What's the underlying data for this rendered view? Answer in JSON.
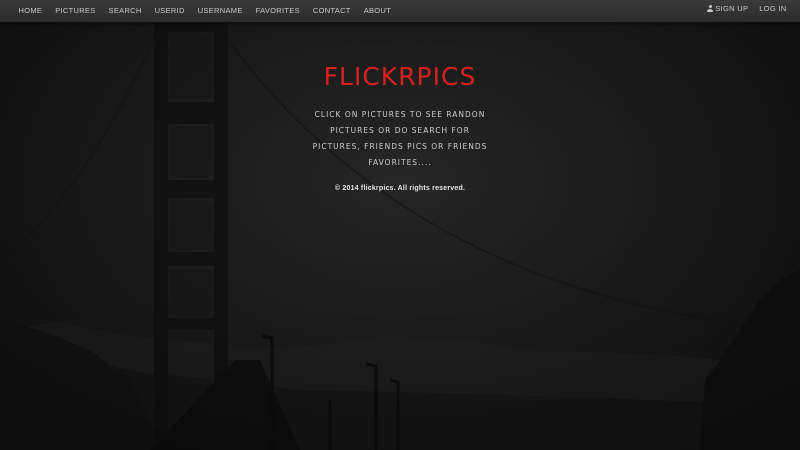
{
  "navbar": {
    "left_items": [
      {
        "label": "HOME"
      },
      {
        "label": "PICTURES"
      },
      {
        "label": "SEARCH"
      },
      {
        "label": "USERID"
      },
      {
        "label": "USERNAME"
      },
      {
        "label": "FAVORITES"
      },
      {
        "label": "CONTACT"
      },
      {
        "label": "ABOUT"
      }
    ],
    "right_items": [
      {
        "label": "SIGN UP",
        "icon": "user-icon"
      },
      {
        "label": "LOG IN"
      }
    ]
  },
  "hero": {
    "brand": "FLICKRPICS",
    "tagline": "CLICK ON PICTURES TO SEE RANDON PICTURES OR DO SEARCH FOR PICTURES, FRIENDS PICS OR FRIENDS FAVORITES....",
    "copyright": "© 2014 flickrpics. All rights reserved."
  },
  "colors": {
    "brand_red": "#d8201d",
    "navbar_bg": "#2f2f2f",
    "page_bg": "#1e1e1e",
    "nav_text": "#c8c8c8"
  }
}
